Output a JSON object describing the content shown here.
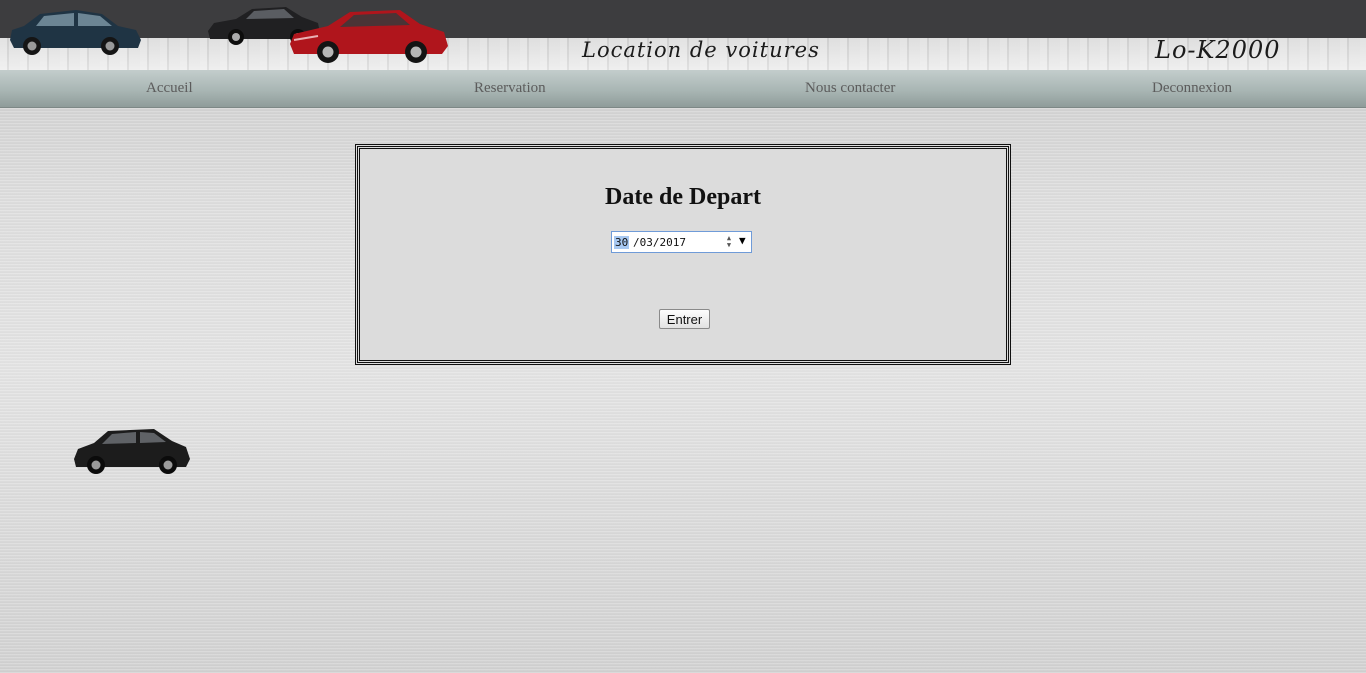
{
  "header": {
    "site_title": "Location de voitures",
    "brand": "Lo-K2000"
  },
  "nav": {
    "items": [
      {
        "label": "Accueil"
      },
      {
        "label": "Reservation"
      },
      {
        "label": "Nous contacter"
      },
      {
        "label": "Deconnexion"
      }
    ]
  },
  "form": {
    "title": "Date de Depart",
    "date": {
      "day": "30",
      "rest": "/03/2017"
    },
    "submit_label": "Entrer"
  },
  "colors": {
    "header_bg": "#3d3d3f",
    "nav_text": "#5c5c5c",
    "panel_bg": "#dcdcdc",
    "date_focus_border": "#6f9bd8"
  },
  "icons": {
    "header_cars": [
      "blue-suv-icon",
      "black-sedan-icon",
      "red-sedan-icon"
    ],
    "decor_car": "black-suv-icon",
    "spinner": "spinner-arrows-icon",
    "dropdown": "chevron-down-icon"
  }
}
